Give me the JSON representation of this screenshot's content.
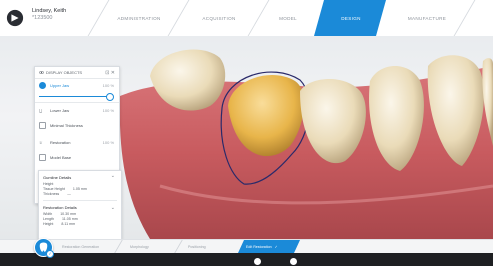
{
  "patient": {
    "name": "Lindsey, Keith",
    "id": "*123500"
  },
  "nav": {
    "steps": [
      {
        "label": "ADMINISTRATION"
      },
      {
        "label": "ACQUISITION"
      },
      {
        "label": "MODEL"
      },
      {
        "label": "DESIGN"
      },
      {
        "label": "MANUFACTURE"
      }
    ],
    "active": "DESIGN"
  },
  "panel": {
    "title": "DISPLAY OBJECTS",
    "upper_jaw": {
      "label": "Upper Jaw",
      "value": "100 %"
    },
    "slider_value": 1.0,
    "lower_jaw": {
      "label": "Lower Jaw",
      "value": "100 %"
    },
    "minimal_thickness": "Minimal Thickness",
    "restoration": {
      "label": "Restoration",
      "value": "100 %"
    },
    "model_base": "Model Base"
  },
  "details": {
    "gumline_title": "Gumline Details",
    "gumline_rows": [
      {
        "label": "Height",
        "value": ""
      },
      {
        "label": "Tissue Height",
        "value": "1.05 mm"
      },
      {
        "label": "Thickness",
        "value": "—"
      }
    ],
    "restoration_title": "Restoration Details",
    "restoration_rows": [
      {
        "label": "Width",
        "value": "10.30 mm"
      },
      {
        "label": "Length",
        "value": "11.05 mm"
      },
      {
        "label": "Height",
        "value": "8.11 mm"
      }
    ]
  },
  "bottom": {
    "steps": [
      {
        "label": "Restoration Generation"
      },
      {
        "label": "Morphology"
      },
      {
        "label": "Positioning"
      },
      {
        "label": "Edit Restoration"
      }
    ]
  },
  "colors": {
    "accent": "#1b8ad8",
    "gum": "#c95a5a",
    "tooth": "#efe1c4",
    "selected_tooth": "#e8b54a"
  }
}
